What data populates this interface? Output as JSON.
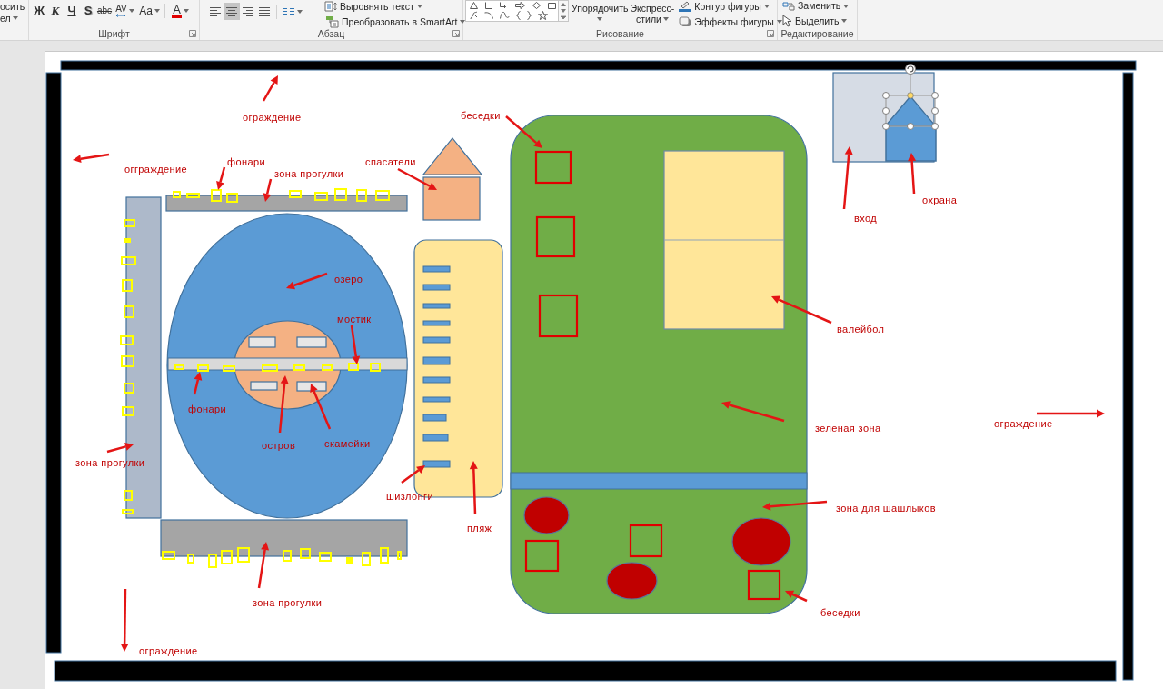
{
  "ribbon": {
    "left_cut_group": {
      "items": [
        {
          "label": "осить",
          "dropdown": false
        },
        {
          "label": "ел",
          "dropdown": true
        }
      ]
    },
    "font_group": {
      "title": "Шрифт",
      "buttons": [
        {
          "kind": "bold",
          "label": "Ж",
          "dropdown": false
        },
        {
          "kind": "italic",
          "label": "К",
          "dropdown": false
        },
        {
          "kind": "underline",
          "label": "Ч",
          "dropdown": false
        },
        {
          "kind": "shadow",
          "label": "S",
          "dropdown": false
        },
        {
          "kind": "strikethrough",
          "label": "abc",
          "dropdown": false
        },
        {
          "kind": "spacing",
          "label": "AV",
          "dropdown": true
        },
        {
          "kind": "case",
          "label": "Aa",
          "dropdown": true
        },
        {
          "kind": "font_color",
          "label": "A",
          "dropdown": true
        }
      ]
    },
    "paragraph_group": {
      "title": "Абзац",
      "align_buttons": [
        {
          "kind": "left",
          "selected": false
        },
        {
          "kind": "center",
          "selected": true
        },
        {
          "kind": "right",
          "selected": false
        },
        {
          "kind": "justify",
          "selected": false
        }
      ],
      "commands": [
        {
          "kind": "text_align",
          "label": "Выровнять текст",
          "dropdown": true
        },
        {
          "kind": "smartart",
          "label": "Преобразовать в SmartArt",
          "dropdown": true
        }
      ]
    },
    "drawing_group": {
      "title": "Рисование",
      "buttons": [
        {
          "kind": "arrange",
          "label_lines": [
            "Упорядочить"
          ]
        },
        {
          "kind": "quick_styles",
          "label_lines": [
            "Экспресс-",
            "стили"
          ]
        }
      ],
      "commands": [
        {
          "kind": "outline",
          "label": "Контур фигуры",
          "dropdown": true
        },
        {
          "kind": "effects",
          "label": "Эффекты фигуры",
          "dropdown": true
        }
      ]
    },
    "editing_group": {
      "title": "Редактирование",
      "commands": [
        {
          "kind": "replace",
          "label": "Заменить",
          "dropdown": true
        },
        {
          "kind": "select",
          "label": "Выделить",
          "dropdown": true
        }
      ]
    }
  },
  "slide": {
    "labels": [
      {
        "text": "беседки"
      },
      {
        "text": "ограждение"
      },
      {
        "text": "фонари"
      },
      {
        "text": "спасатели"
      },
      {
        "text": "огграждение"
      },
      {
        "text": "зона прогулки"
      },
      {
        "text": "охрана"
      },
      {
        "text": "вход"
      },
      {
        "text": "озеро"
      },
      {
        "text": "мостик"
      },
      {
        "text": "валейбол"
      },
      {
        "text": "фонари"
      },
      {
        "text": "ограждение"
      },
      {
        "text": "зеленая зона"
      },
      {
        "text": "скамейки"
      },
      {
        "text": "остров"
      },
      {
        "text": "зона прогулки"
      },
      {
        "text": "шизлонги"
      },
      {
        "text": "зона для шашлыков"
      },
      {
        "text": "пляж"
      },
      {
        "text": "зона прогулки"
      },
      {
        "text": "беседки"
      },
      {
        "text": "ограждение"
      }
    ],
    "guard_house": {
      "roof_selected": true
    }
  }
}
